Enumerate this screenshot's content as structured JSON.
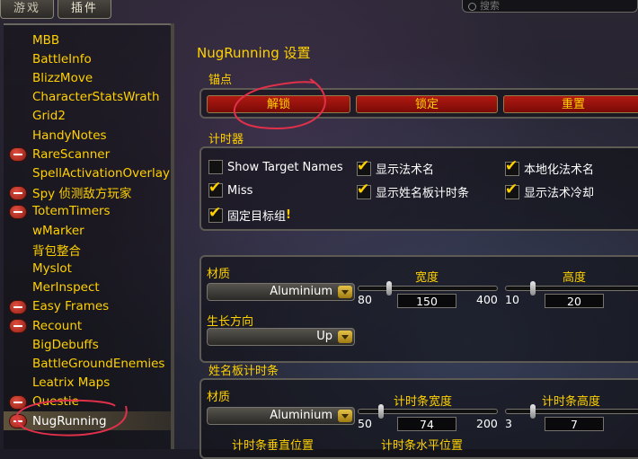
{
  "tabs": [
    {
      "label": "游戏"
    },
    {
      "label": "插件"
    }
  ],
  "search": {
    "placeholder": "搜索"
  },
  "sidebar": {
    "items": [
      {
        "label": "MBB",
        "minus": false
      },
      {
        "label": "BattleInfo",
        "minus": false
      },
      {
        "label": "BlizzMove",
        "minus": false
      },
      {
        "label": "CharacterStatsWrath",
        "minus": false
      },
      {
        "label": "Grid2",
        "minus": false
      },
      {
        "label": "HandyNotes",
        "minus": false
      },
      {
        "label": "RareScanner",
        "minus": true
      },
      {
        "label": "SpellActivationOverlay",
        "minus": false
      },
      {
        "label": "Spy 侦测敌方玩家",
        "minus": true
      },
      {
        "label": "TotemTimers",
        "minus": true
      },
      {
        "label": "wMarker",
        "minus": false
      },
      {
        "label": "背包整合",
        "minus": false
      },
      {
        "label": "Myslot",
        "minus": false
      },
      {
        "label": "MerInspect",
        "minus": false
      },
      {
        "label": "Easy Frames",
        "minus": true
      },
      {
        "label": "Recount",
        "minus": true
      },
      {
        "label": "BigDebuffs",
        "minus": false
      },
      {
        "label": "BattleGroundEnemies",
        "minus": false
      },
      {
        "label": "Leatrix Maps",
        "minus": false
      },
      {
        "label": "Questie",
        "minus": true
      },
      {
        "label": "NugRunning",
        "minus": true,
        "selected": true
      }
    ]
  },
  "main": {
    "title": "NugRunning 设置",
    "anchor": {
      "label": "锚点",
      "unlock": "解锁",
      "lock": "锁定",
      "reset": "重置"
    },
    "timer": {
      "label": "计时器",
      "options": [
        {
          "label": "Show Target Names",
          "checked": false
        },
        {
          "label": "显示法术名",
          "checked": true
        },
        {
          "label": "本地化法术名",
          "checked": true
        },
        {
          "label": "Miss",
          "checked": true
        },
        {
          "label": "显示姓名板计时条",
          "checked": true
        },
        {
          "label": "显示法术冷却",
          "checked": true
        },
        {
          "label": "固定目标组",
          "checked": true,
          "warn": "!"
        }
      ]
    },
    "texture1": {
      "label": "材质",
      "value": "Aluminium"
    },
    "width": {
      "label": "宽度",
      "min": "80",
      "max": "400",
      "value": "150",
      "fraction": 0.22
    },
    "height": {
      "label": "高度",
      "min": "10",
      "value": "20",
      "fraction": 0.2
    },
    "growth": {
      "label": "生长方向",
      "value": "Up"
    },
    "nameplate": {
      "label": "姓名板计时条"
    },
    "texture2": {
      "label": "材质",
      "value": "Aluminium"
    },
    "barwidth": {
      "label": "计时条宽度",
      "min": "50",
      "max": "200",
      "value": "74",
      "fraction": 0.16
    },
    "barheight": {
      "label": "计时条高度",
      "min": "3",
      "value": "7",
      "fraction": 0.2
    },
    "vpos": {
      "label": "计时条垂直位置"
    },
    "hpos": {
      "label": "计时条水平位置"
    }
  },
  "colors": {
    "accent": "#ffd100",
    "button_red": "#9a1410",
    "annotation": "#e0304a"
  }
}
